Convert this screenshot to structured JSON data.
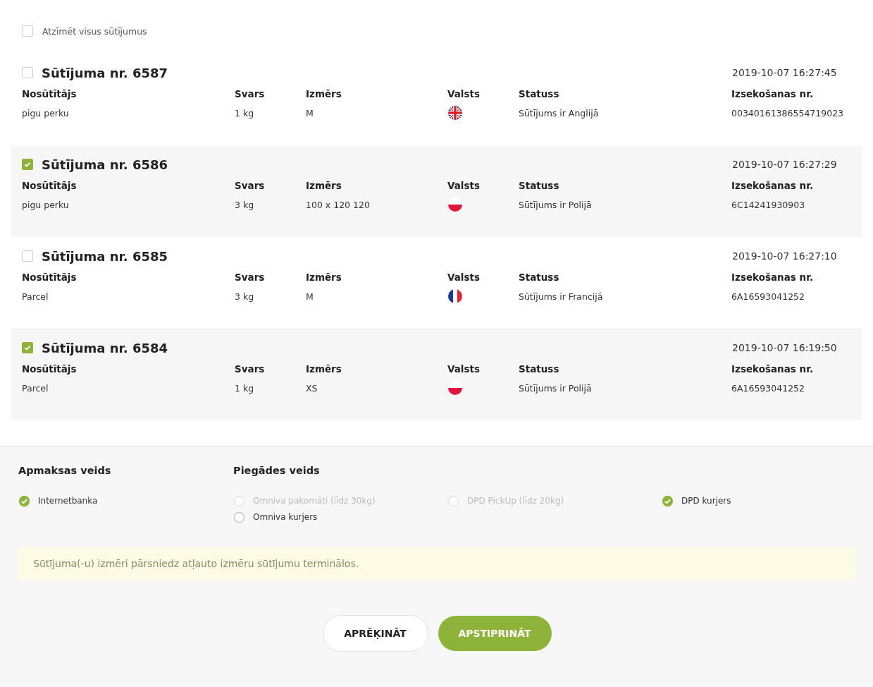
{
  "select_all": {
    "label": "Atzīmēt visus sūtījumus",
    "checked": false
  },
  "shipments": [
    {
      "title": "Sūtījuma nr. 6587",
      "date": "2019-10-07 16:27:45",
      "checked": false,
      "columns": [
        "Nosūtītājs",
        "Svars",
        "Izmērs",
        "Valsts",
        "Statuss",
        "Izsekošanas nr."
      ],
      "sender": "pigu perku",
      "weight": "1 kg",
      "size": "M",
      "kind": "gb",
      "status": "Sūtījums ir Anglijā",
      "tracking": "00340161386554719023"
    },
    {
      "title": "Sūtījuma nr. 6586",
      "date": "2019-10-07 16:27:29",
      "checked": true,
      "columns": [
        "Nosūtītājs",
        "Svars",
        "Izmērs",
        "Valsts",
        "Statuss",
        "Izsekošanas nr."
      ],
      "sender": "pigu perku",
      "weight": "3 kg",
      "size": "100 x 120 120",
      "kind": "pl",
      "status": "Sūtījums ir Polijā",
      "tracking": "6C14241930903"
    },
    {
      "title": "Sūtījuma nr. 6585",
      "date": "2019-10-07 16:27:10",
      "checked": false,
      "columns": [
        "Nosūtītājs",
        "Svars",
        "Izmērs",
        "Valsts",
        "Statuss",
        "Izsekošanas nr."
      ],
      "sender": "Parcel",
      "weight": "3 kg",
      "size": "M",
      "kind": "fr",
      "status": "Sūtījums ir Francijā",
      "tracking": "6A16593041252"
    },
    {
      "title": "Sūtījuma nr. 6584",
      "date": "2019-10-07 16:19:50",
      "checked": true,
      "columns": [
        "Nosūtītājs",
        "Svars",
        "Izmērs",
        "Valsts",
        "Statuss",
        "Izsekošanas nr."
      ],
      "sender": "Parcel",
      "weight": "1 kg",
      "size": "XS",
      "kind": "pl",
      "status": "Sūtījums ir Polijā",
      "tracking": "6A16593041252"
    }
  ],
  "payment": {
    "title": "Apmaksas veids",
    "options": [
      {
        "label": "Internetbanka",
        "selected": true
      }
    ]
  },
  "delivery": {
    "title": "Piegādes veids",
    "options": [
      {
        "label": "Omniva pakomāti (līdz 30kg)",
        "selected": false,
        "disabled": true
      },
      {
        "label": "DPD PickUp (līdz 20kg)",
        "selected": false,
        "disabled": true
      },
      {
        "label": "DPD kurjers",
        "selected": true,
        "disabled": false
      },
      {
        "label": "Omniva kurjers",
        "selected": false,
        "disabled": false
      }
    ]
  },
  "notice": "Sūtījuma(-u) izmēri pārsniedz atļauto izmēru sūtījumu terminālos.",
  "buttons": [
    {
      "label": "APRĒĶINĀT",
      "kind": "secondary"
    },
    {
      "label": "APSTIPRINĀT",
      "kind": "primary"
    }
  ]
}
